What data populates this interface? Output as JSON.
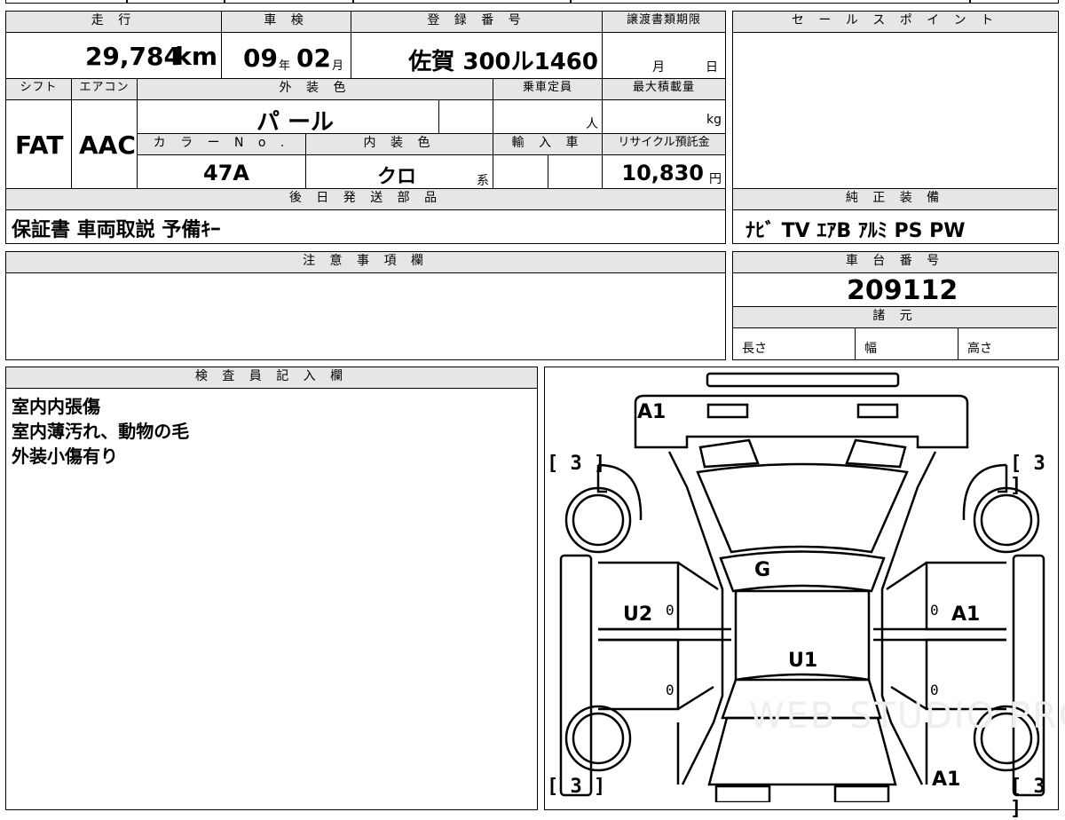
{
  "top": {
    "mileage_label": "走 行",
    "mileage_value": "29,784",
    "mileage_unit": "km",
    "shaken_label": "車 検",
    "shaken_year": "09",
    "shaken_year_unit": "年",
    "shaken_month": "02",
    "shaken_month_unit": "月",
    "reg_label": "登 録 番 号",
    "reg_value": "佐賀 300ル1460",
    "deadline_label": "譲渡書類期限",
    "deadline_month": "月",
    "deadline_day": "日"
  },
  "row2": {
    "shift_label": "シフト",
    "shift_value": "FAT",
    "ac_label": "エアコン",
    "ac_value": "AAC",
    "exterior_label": "外 装 色",
    "exterior_value": "パ ール",
    "capacity_label": "乗車定員",
    "capacity_unit": "人",
    "maxload_label": "最大積載量",
    "maxload_unit": "kg",
    "colorno_label": "カ ラ ー N o .",
    "colorno_value": "47A",
    "interior_label": "内 装 色",
    "interior_value": "クロ",
    "interior_suffix": "系",
    "import_label": "輸 入 車",
    "recycle_label": "リサイクル預託金",
    "recycle_value": "10,830",
    "recycle_unit": "円"
  },
  "shipping": {
    "label": "後 日 発 送 部 品",
    "value": "保証書 車両取説 予備ｷｰ"
  },
  "sales": {
    "label": "セ ー ル ス ポ イ ン ト"
  },
  "genuine": {
    "label": "純 正 装 備",
    "value": "ﾅﾋﾞ TV ｴｱB ｱﾙﾐ PS PW"
  },
  "notes": {
    "label": "注 意 事 項 欄"
  },
  "chassis": {
    "label": "車 台 番 号",
    "value": "209112",
    "spec_label": "諸 元",
    "length_label": "長さ",
    "width_label": "幅",
    "height_label": "高さ"
  },
  "inspector": {
    "label": "検 査 員 記 入 欄",
    "lines": [
      "室内内張傷",
      "室内薄汚れ、動物の毛",
      "外装小傷有り"
    ]
  },
  "diagram": {
    "marks": {
      "front": "A1",
      "hood": "G",
      "roof": "U1",
      "left_door": "U2",
      "right_door": "A1",
      "rear_right": "A1"
    },
    "tires": [
      "3",
      "3",
      "3",
      "3"
    ],
    "zeros": [
      "0",
      "0",
      "0",
      "0"
    ],
    "watermark": "WEB STUDIO PRO"
  }
}
